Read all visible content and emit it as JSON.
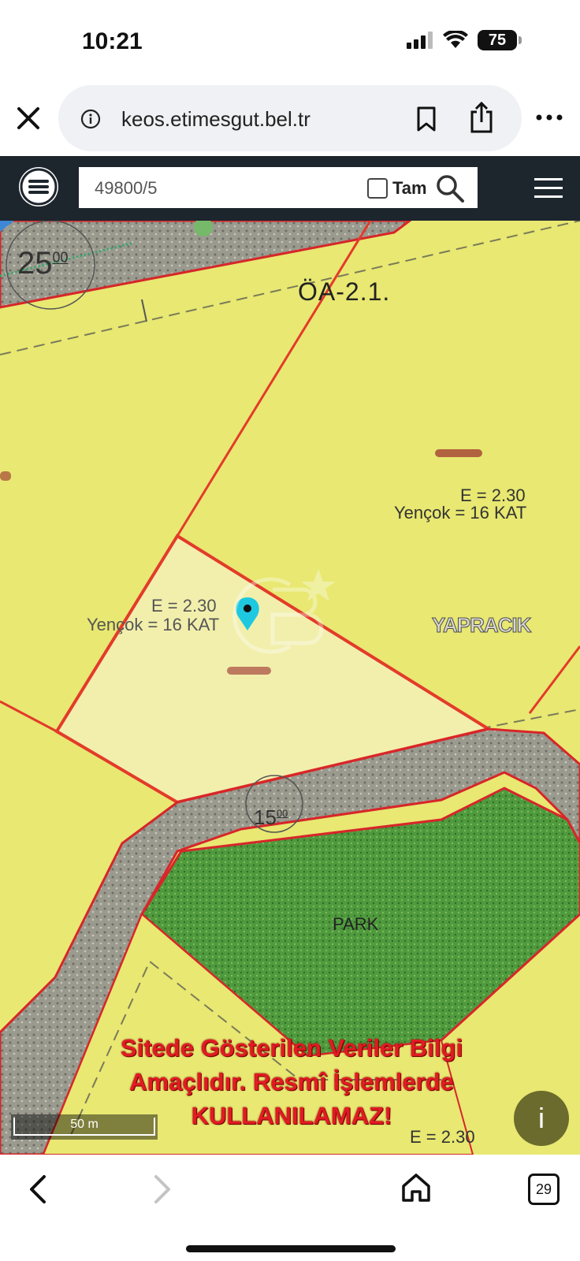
{
  "status_bar": {
    "time": "10:21",
    "battery": "75"
  },
  "browser": {
    "url": "keos.etimesgut.bel.tr"
  },
  "toolbar": {
    "search_value": "49800/5",
    "tam_label": "Tam"
  },
  "map": {
    "labels": {
      "zone": "ÖA-2.1.",
      "e_top": "E = 2.30",
      "yencok_top": "Yençok = 16 KAT",
      "e_parcel": "E = 2.30",
      "yencok_parcel": "Yençok = 16 KAT",
      "district": "YAPRACIK",
      "park": "PARK",
      "e_bottom": "E = 2.30",
      "road_width_top": "25",
      "road_width_top_sup": "00",
      "road_width_mid": "15",
      "road_width_mid_sup": "00"
    },
    "warning_line1": "Sitede Gösterilen Veriler Bilgi",
    "warning_line2": "Amaçlıdır. Resmî İşlemlerde",
    "warning_line3": "KULLANILAMAZ!",
    "scale_label": "50 m",
    "info_button": "i"
  },
  "bottom_nav": {
    "tabs_count": "29"
  },
  "colors": {
    "zone_yellow": "#e8e872",
    "parcel_red": "#e33b2a",
    "park_green": "#4f9a3d",
    "toolbar": "#1d252d",
    "marker": "#1ec8e0"
  }
}
